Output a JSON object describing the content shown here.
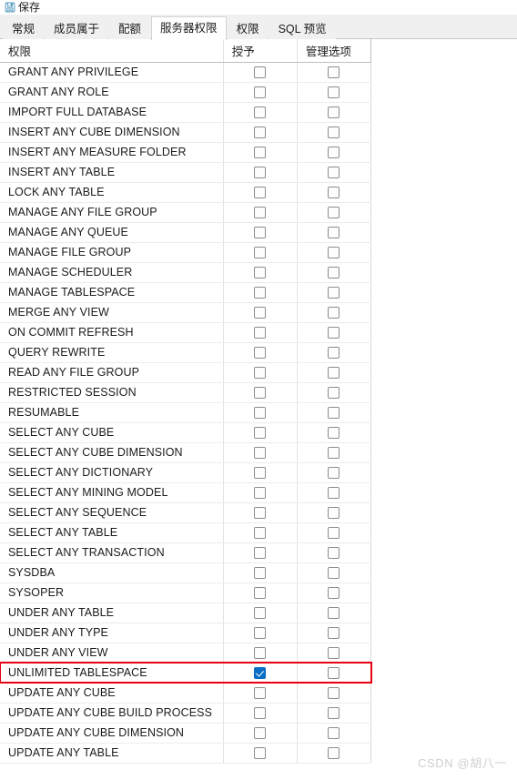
{
  "toolbar": {
    "save_label": "保存",
    "save_icon": "floppy-disk-icon"
  },
  "tabs": [
    {
      "label": "常规",
      "active": false
    },
    {
      "label": "成员属于",
      "active": false
    },
    {
      "label": "配额",
      "active": false
    },
    {
      "label": "服务器权限",
      "active": true
    },
    {
      "label": "权限",
      "active": false
    },
    {
      "label": "SQL 预览",
      "active": false
    }
  ],
  "grid": {
    "columns": [
      "权限",
      "授予",
      "管理选项"
    ],
    "rows": [
      {
        "privilege": "GRANT ANY PRIVILEGE",
        "grant": false,
        "admin": false,
        "highlighted": false
      },
      {
        "privilege": "GRANT ANY ROLE",
        "grant": false,
        "admin": false,
        "highlighted": false
      },
      {
        "privilege": "IMPORT FULL DATABASE",
        "grant": false,
        "admin": false,
        "highlighted": false
      },
      {
        "privilege": "INSERT ANY CUBE DIMENSION",
        "grant": false,
        "admin": false,
        "highlighted": false
      },
      {
        "privilege": "INSERT ANY MEASURE FOLDER",
        "grant": false,
        "admin": false,
        "highlighted": false
      },
      {
        "privilege": "INSERT ANY TABLE",
        "grant": false,
        "admin": false,
        "highlighted": false
      },
      {
        "privilege": "LOCK ANY TABLE",
        "grant": false,
        "admin": false,
        "highlighted": false
      },
      {
        "privilege": "MANAGE ANY FILE GROUP",
        "grant": false,
        "admin": false,
        "highlighted": false
      },
      {
        "privilege": "MANAGE ANY QUEUE",
        "grant": false,
        "admin": false,
        "highlighted": false
      },
      {
        "privilege": "MANAGE FILE GROUP",
        "grant": false,
        "admin": false,
        "highlighted": false
      },
      {
        "privilege": "MANAGE SCHEDULER",
        "grant": false,
        "admin": false,
        "highlighted": false
      },
      {
        "privilege": "MANAGE TABLESPACE",
        "grant": false,
        "admin": false,
        "highlighted": false
      },
      {
        "privilege": "MERGE ANY VIEW",
        "grant": false,
        "admin": false,
        "highlighted": false
      },
      {
        "privilege": "ON COMMIT REFRESH",
        "grant": false,
        "admin": false,
        "highlighted": false
      },
      {
        "privilege": "QUERY REWRITE",
        "grant": false,
        "admin": false,
        "highlighted": false
      },
      {
        "privilege": "READ ANY FILE GROUP",
        "grant": false,
        "admin": false,
        "highlighted": false
      },
      {
        "privilege": "RESTRICTED SESSION",
        "grant": false,
        "admin": false,
        "highlighted": false
      },
      {
        "privilege": "RESUMABLE",
        "grant": false,
        "admin": false,
        "highlighted": false
      },
      {
        "privilege": "SELECT ANY CUBE",
        "grant": false,
        "admin": false,
        "highlighted": false
      },
      {
        "privilege": "SELECT ANY CUBE DIMENSION",
        "grant": false,
        "admin": false,
        "highlighted": false
      },
      {
        "privilege": "SELECT ANY DICTIONARY",
        "grant": false,
        "admin": false,
        "highlighted": false
      },
      {
        "privilege": "SELECT ANY MINING MODEL",
        "grant": false,
        "admin": false,
        "highlighted": false
      },
      {
        "privilege": "SELECT ANY SEQUENCE",
        "grant": false,
        "admin": false,
        "highlighted": false
      },
      {
        "privilege": "SELECT ANY TABLE",
        "grant": false,
        "admin": false,
        "highlighted": false
      },
      {
        "privilege": "SELECT ANY TRANSACTION",
        "grant": false,
        "admin": false,
        "highlighted": false
      },
      {
        "privilege": "SYSDBA",
        "grant": false,
        "admin": false,
        "highlighted": false
      },
      {
        "privilege": "SYSOPER",
        "grant": false,
        "admin": false,
        "highlighted": false
      },
      {
        "privilege": "UNDER ANY TABLE",
        "grant": false,
        "admin": false,
        "highlighted": false
      },
      {
        "privilege": "UNDER ANY TYPE",
        "grant": false,
        "admin": false,
        "highlighted": false
      },
      {
        "privilege": "UNDER ANY VIEW",
        "grant": false,
        "admin": false,
        "highlighted": false
      },
      {
        "privilege": "UNLIMITED TABLESPACE",
        "grant": true,
        "admin": false,
        "highlighted": true
      },
      {
        "privilege": "UPDATE ANY CUBE",
        "grant": false,
        "admin": false,
        "highlighted": false
      },
      {
        "privilege": "UPDATE ANY CUBE BUILD PROCESS",
        "grant": false,
        "admin": false,
        "highlighted": false
      },
      {
        "privilege": "UPDATE ANY CUBE DIMENSION",
        "grant": false,
        "admin": false,
        "highlighted": false
      },
      {
        "privilege": "UPDATE ANY TABLE",
        "grant": false,
        "admin": false,
        "highlighted": false
      }
    ]
  },
  "watermark": {
    "text": "CSDN @胡八一"
  },
  "colors": {
    "accent": "#0b6fc4",
    "highlight": "#e60012",
    "tab_bar": "#f0f0f0",
    "grid_line": "#e3e3e3"
  }
}
